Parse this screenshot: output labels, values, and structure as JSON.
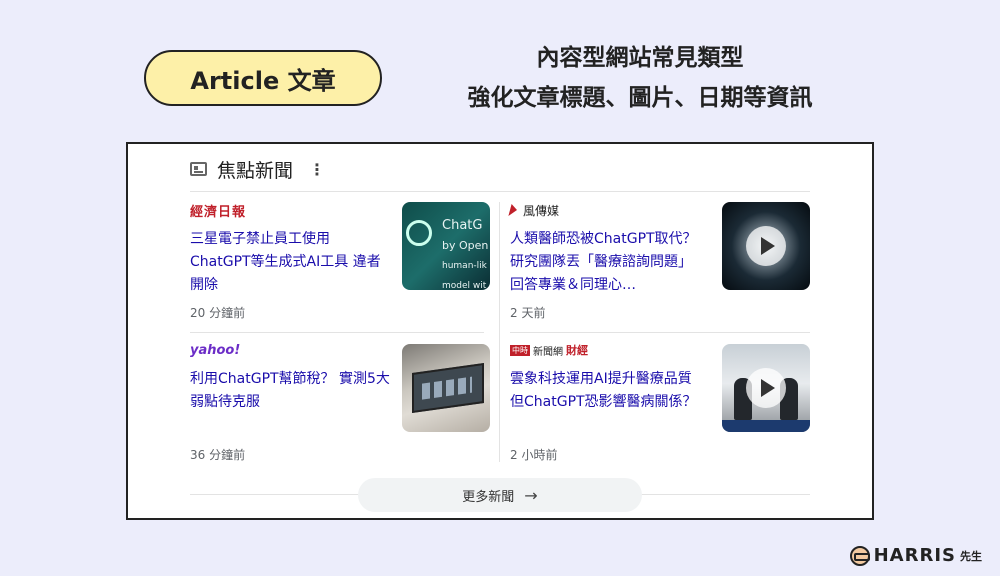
{
  "badge": "Article 文章",
  "headline": {
    "line1": "內容型網站常見類型",
    "line2": "強化文章標題、圖片、日期等資訊"
  },
  "panel": {
    "title": "焦點新聞",
    "more_label": "更多新聞",
    "articles": [
      {
        "source": "經濟日報",
        "title": "三星電子禁止員工使用ChatGPT等生成式AI工具 違者開除",
        "time": "20 分鐘前",
        "thumb_text": [
          "ChatG",
          "by Open",
          "human-lik",
          "model wit"
        ]
      },
      {
        "source": "風傳媒",
        "title": "人類醫師恐被ChatGPT取代？研究團隊丟「醫療諮詢問題」 回答專業＆同理心…",
        "time": "2 天前"
      },
      {
        "source": "yahoo!",
        "title": "利用ChatGPT幫節稅？ 實測5大弱點待克服",
        "time": "36 分鐘前"
      },
      {
        "source_a": "新聞網",
        "source_b": "財經",
        "title": "雲象科技運用AI提升醫療品質 但ChatGPT恐影響醫病關係？",
        "time": "2 小時前"
      }
    ]
  },
  "brand": {
    "name": "HARRIS",
    "suffix": "先生"
  }
}
